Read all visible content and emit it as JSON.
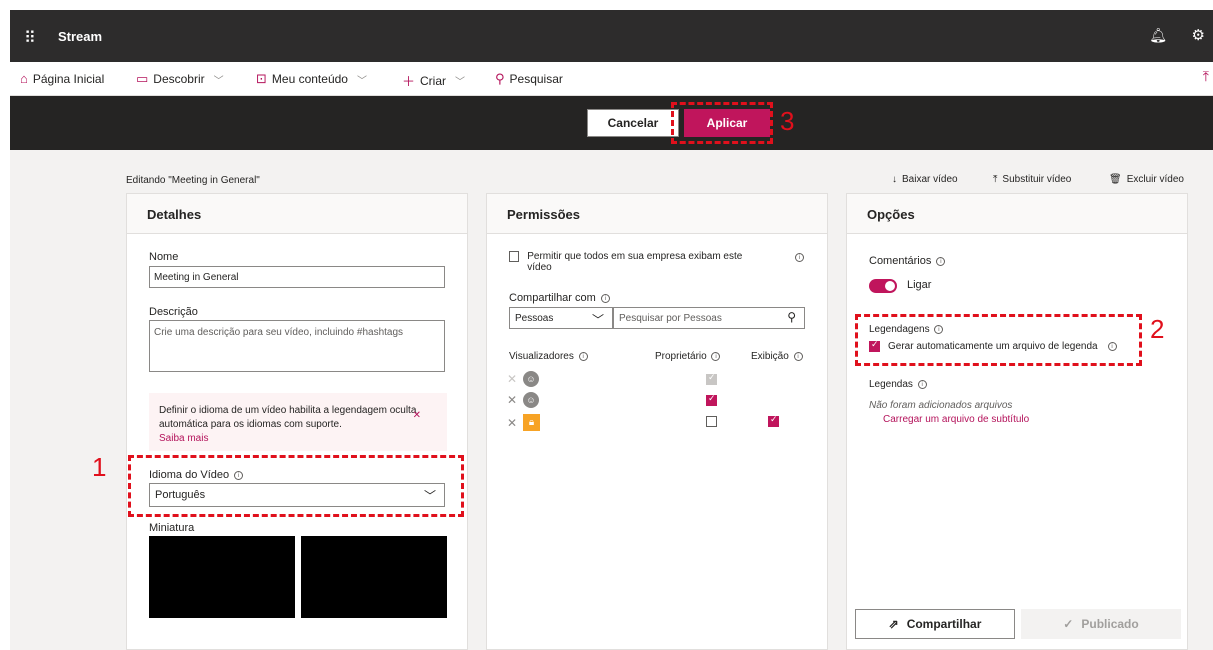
{
  "app": {
    "title": "Stream"
  },
  "nav": {
    "home": "Página Inicial",
    "discover": "Descobrir",
    "my_content": "Meu conteúdo",
    "create": "Criar",
    "search": "Pesquisar"
  },
  "actions": {
    "cancel": "Cancelar",
    "apply": "Aplicar"
  },
  "editing_label": "Editando \"Meeting in General\"",
  "video_actions": {
    "download": "Baixar vídeo",
    "replace": "Substituir vídeo",
    "delete": "Excluir vídeo"
  },
  "details": {
    "title": "Detalhes",
    "name_label": "Nome",
    "name_value": "Meeting in General",
    "description_label": "Descrição",
    "description_placeholder": "Crie uma descrição para seu vídeo, incluindo #hashtags",
    "info_text": "Definir o idioma de um vídeo habilita a legendagem oculta automática para os idiomas com suporte.",
    "info_link": "Saiba mais",
    "language_label": "Idioma do Vídeo",
    "language_value": "Português",
    "thumbnail_label": "Miniatura"
  },
  "permissions": {
    "title": "Permissões",
    "allow_all": "Permitir que todos em sua empresa exibam este vídeo",
    "share_with_label": "Compartilhar com",
    "share_with_value": "Pessoas",
    "search_people_placeholder": "Pesquisar por Pessoas",
    "viewers_label": "Visualizadores",
    "owner_label": "Proprietário",
    "view_label": "Exibição"
  },
  "options": {
    "title": "Opções",
    "comments_label": "Comentários",
    "comments_toggle": "Ligar",
    "captions_label": "Legendagens",
    "auto_caption": "Gerar automaticamente um arquivo de legenda",
    "subtitles_label": "Legendas",
    "no_files": "Não foram adicionados arquivos",
    "upload_link": "Carregar um arquivo de subtítulo",
    "share_button": "Compartilhar",
    "published_button": "Publicado"
  },
  "callouts": {
    "one": "1",
    "two": "2",
    "three": "3"
  },
  "colors": {
    "accent": "#c0155c",
    "topbar": "#2d2c2c",
    "callout": "#e0101c"
  }
}
